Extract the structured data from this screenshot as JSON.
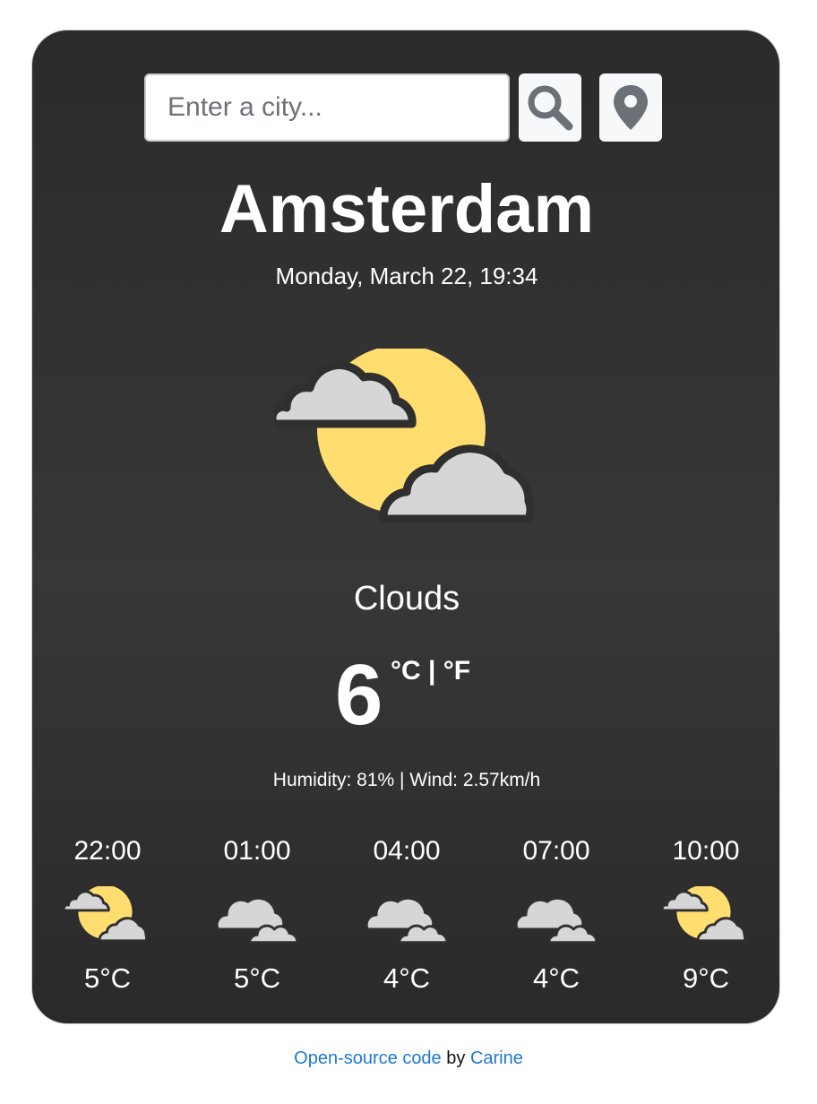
{
  "search": {
    "placeholder": "Enter a city..."
  },
  "buttons": {
    "search_icon": "search-icon",
    "location_icon": "map-pin-icon"
  },
  "weather": {
    "city": "Amsterdam",
    "date": "Monday, March 22, 19:34",
    "description": "Clouds",
    "temperature": "6",
    "unit_celsius": "°C",
    "unit_separator": " | ",
    "unit_fahrenheit": "°F",
    "details": "Humidity: 81% | Wind: 2.57km/h",
    "icon": "partly-cloudy-icon"
  },
  "forecast": [
    {
      "time": "22:00",
      "temp": "5°C",
      "icon": "partly-cloudy-icon"
    },
    {
      "time": "01:00",
      "temp": "5°C",
      "icon": "clouds-icon"
    },
    {
      "time": "04:00",
      "temp": "4°C",
      "icon": "clouds-icon"
    },
    {
      "time": "07:00",
      "temp": "4°C",
      "icon": "clouds-icon"
    },
    {
      "time": "10:00",
      "temp": "9°C",
      "icon": "partly-cloudy-icon"
    }
  ],
  "footer": {
    "code_link": "Open-source code",
    "by": " by ",
    "author_link": "Carine"
  },
  "colors": {
    "card_bg": "#2f2f2f",
    "sun": "#ffdd6e",
    "cloud": "#d6d6d6",
    "link": "#1f78d1"
  }
}
